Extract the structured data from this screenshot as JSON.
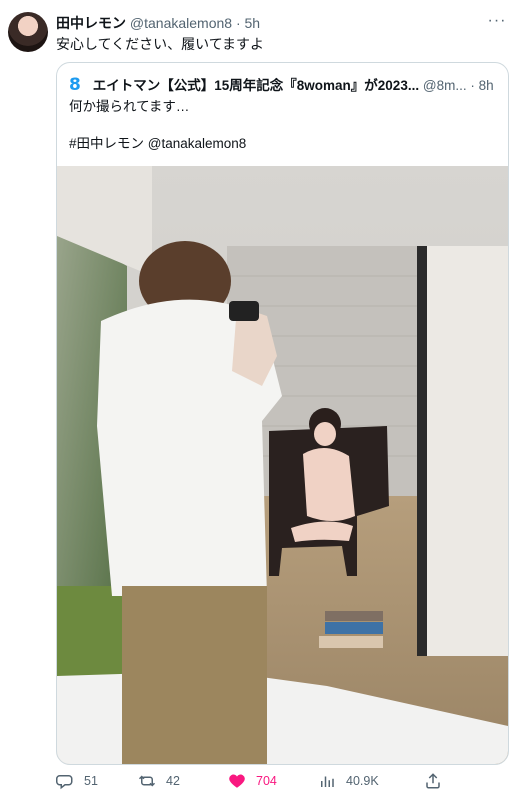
{
  "tweet": {
    "author_name": "田中レモン",
    "author_handle": "@tanakalemon8",
    "separator": "·",
    "time": "5h",
    "text": "安心してください、履いてますよ"
  },
  "quoted": {
    "author_name": "エイトマン【公式】15周年記念『8woman』が2023...",
    "author_handle": "@8m...",
    "separator": "·",
    "time": "8h",
    "line1": "何か撮られてます…",
    "line2": "#田中レモン @tanakalemon8"
  },
  "actions": {
    "replies": "51",
    "retweets": "42",
    "likes": "704",
    "views": "40.9K"
  },
  "colors": {
    "like_active": "#f91880",
    "meta": "#536471",
    "border": "#cfd9de"
  }
}
